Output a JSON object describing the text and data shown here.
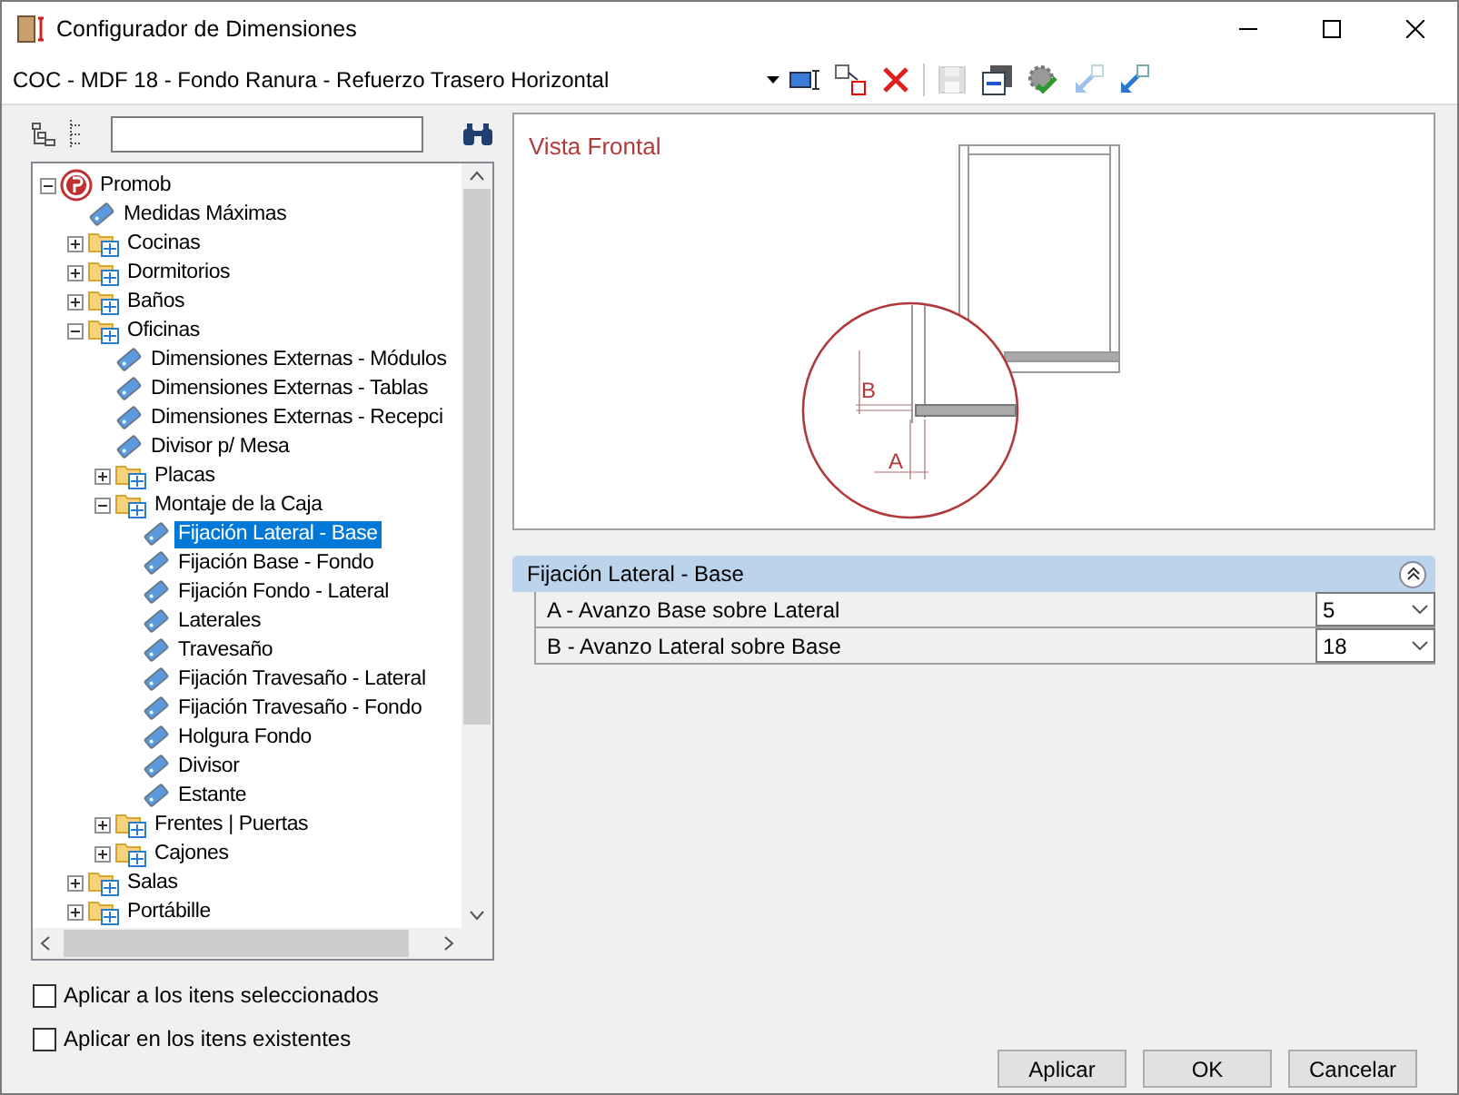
{
  "window": {
    "title": "Configurador de Dimensiones"
  },
  "combo": {
    "value": "COC - MDF 18 - Fondo Ranura - Refuerzo Trasero Horizontal"
  },
  "toolbar": [
    {
      "kind": "resize",
      "disabled": false
    },
    {
      "kind": "swap",
      "disabled": false
    },
    {
      "kind": "delete",
      "disabled": false
    },
    {
      "kind": "save",
      "disabled": true
    },
    {
      "kind": "export",
      "disabled": false
    },
    {
      "kind": "check",
      "disabled": false
    },
    {
      "kind": "arrow-up",
      "disabled": true
    },
    {
      "kind": "arrow-down",
      "disabled": false
    }
  ],
  "tree": [
    {
      "label": "Promob",
      "kind": "root",
      "expanded": true,
      "selected": false,
      "children": [
        {
          "label": "Medidas Máximas",
          "kind": "leaf",
          "selected": false
        },
        {
          "label": "Cocinas",
          "kind": "folder",
          "expanded": false,
          "selected": false
        },
        {
          "label": "Dormitorios",
          "kind": "folder",
          "expanded": false,
          "selected": false
        },
        {
          "label": "Baños",
          "kind": "folder",
          "expanded": false,
          "selected": false
        },
        {
          "label": "Oficinas",
          "kind": "folder",
          "expanded": true,
          "selected": false,
          "children": [
            {
              "label": "Dimensiones Externas - Módulos",
              "kind": "leaf",
              "selected": false
            },
            {
              "label": "Dimensiones Externas - Tablas",
              "kind": "leaf",
              "selected": false
            },
            {
              "label": "Dimensiones Externas - Recepci",
              "kind": "leaf",
              "selected": false
            },
            {
              "label": "Divisor p/ Mesa",
              "kind": "leaf",
              "selected": false
            },
            {
              "label": "Placas",
              "kind": "folder",
              "expanded": false,
              "selected": false
            },
            {
              "label": "Montaje de la Caja",
              "kind": "folder",
              "expanded": true,
              "selected": false,
              "children": [
                {
                  "label": "Fijación Lateral - Base",
                  "kind": "leaf",
                  "selected": true
                },
                {
                  "label": "Fijación Base - Fondo",
                  "kind": "leaf",
                  "selected": false
                },
                {
                  "label": "Fijación Fondo - Lateral",
                  "kind": "leaf",
                  "selected": false
                },
                {
                  "label": "Laterales",
                  "kind": "leaf",
                  "selected": false
                },
                {
                  "label": "Travesaño",
                  "kind": "leaf",
                  "selected": false
                },
                {
                  "label": "Fijación Travesaño - Lateral",
                  "kind": "leaf",
                  "selected": false
                },
                {
                  "label": "Fijación Travesaño - Fondo",
                  "kind": "leaf",
                  "selected": false
                },
                {
                  "label": "Holgura Fondo",
                  "kind": "leaf",
                  "selected": false
                },
                {
                  "label": "Divisor",
                  "kind": "leaf",
                  "selected": false
                },
                {
                  "label": "Estante",
                  "kind": "leaf",
                  "selected": false
                }
              ]
            },
            {
              "label": "Frentes | Puertas",
              "kind": "folder",
              "expanded": false,
              "selected": false
            },
            {
              "label": "Cajones",
              "kind": "folder",
              "expanded": false,
              "selected": false
            }
          ]
        },
        {
          "label": "Salas",
          "kind": "folder",
          "expanded": false,
          "selected": false
        },
        {
          "label": "Portábille",
          "kind": "folder",
          "expanded": false,
          "selected": false
        }
      ]
    }
  ],
  "preview": {
    "title": "Vista Frontal",
    "marker_a": "A",
    "marker_b": "B"
  },
  "properties": {
    "category": "Fijación Lateral - Base",
    "expanded": true,
    "rows": [
      {
        "label": "A - Avanzo Base sobre Lateral",
        "value": "5"
      },
      {
        "label": "B - Avanzo Lateral sobre Base",
        "value": "18"
      }
    ]
  },
  "options": [
    {
      "label": "Aplicar a los itens seleccionados",
      "checked": false
    },
    {
      "label": "Aplicar en los itens existentes",
      "checked": false
    }
  ],
  "buttons": [
    "Aplicar",
    "OK",
    "Cancelar"
  ]
}
